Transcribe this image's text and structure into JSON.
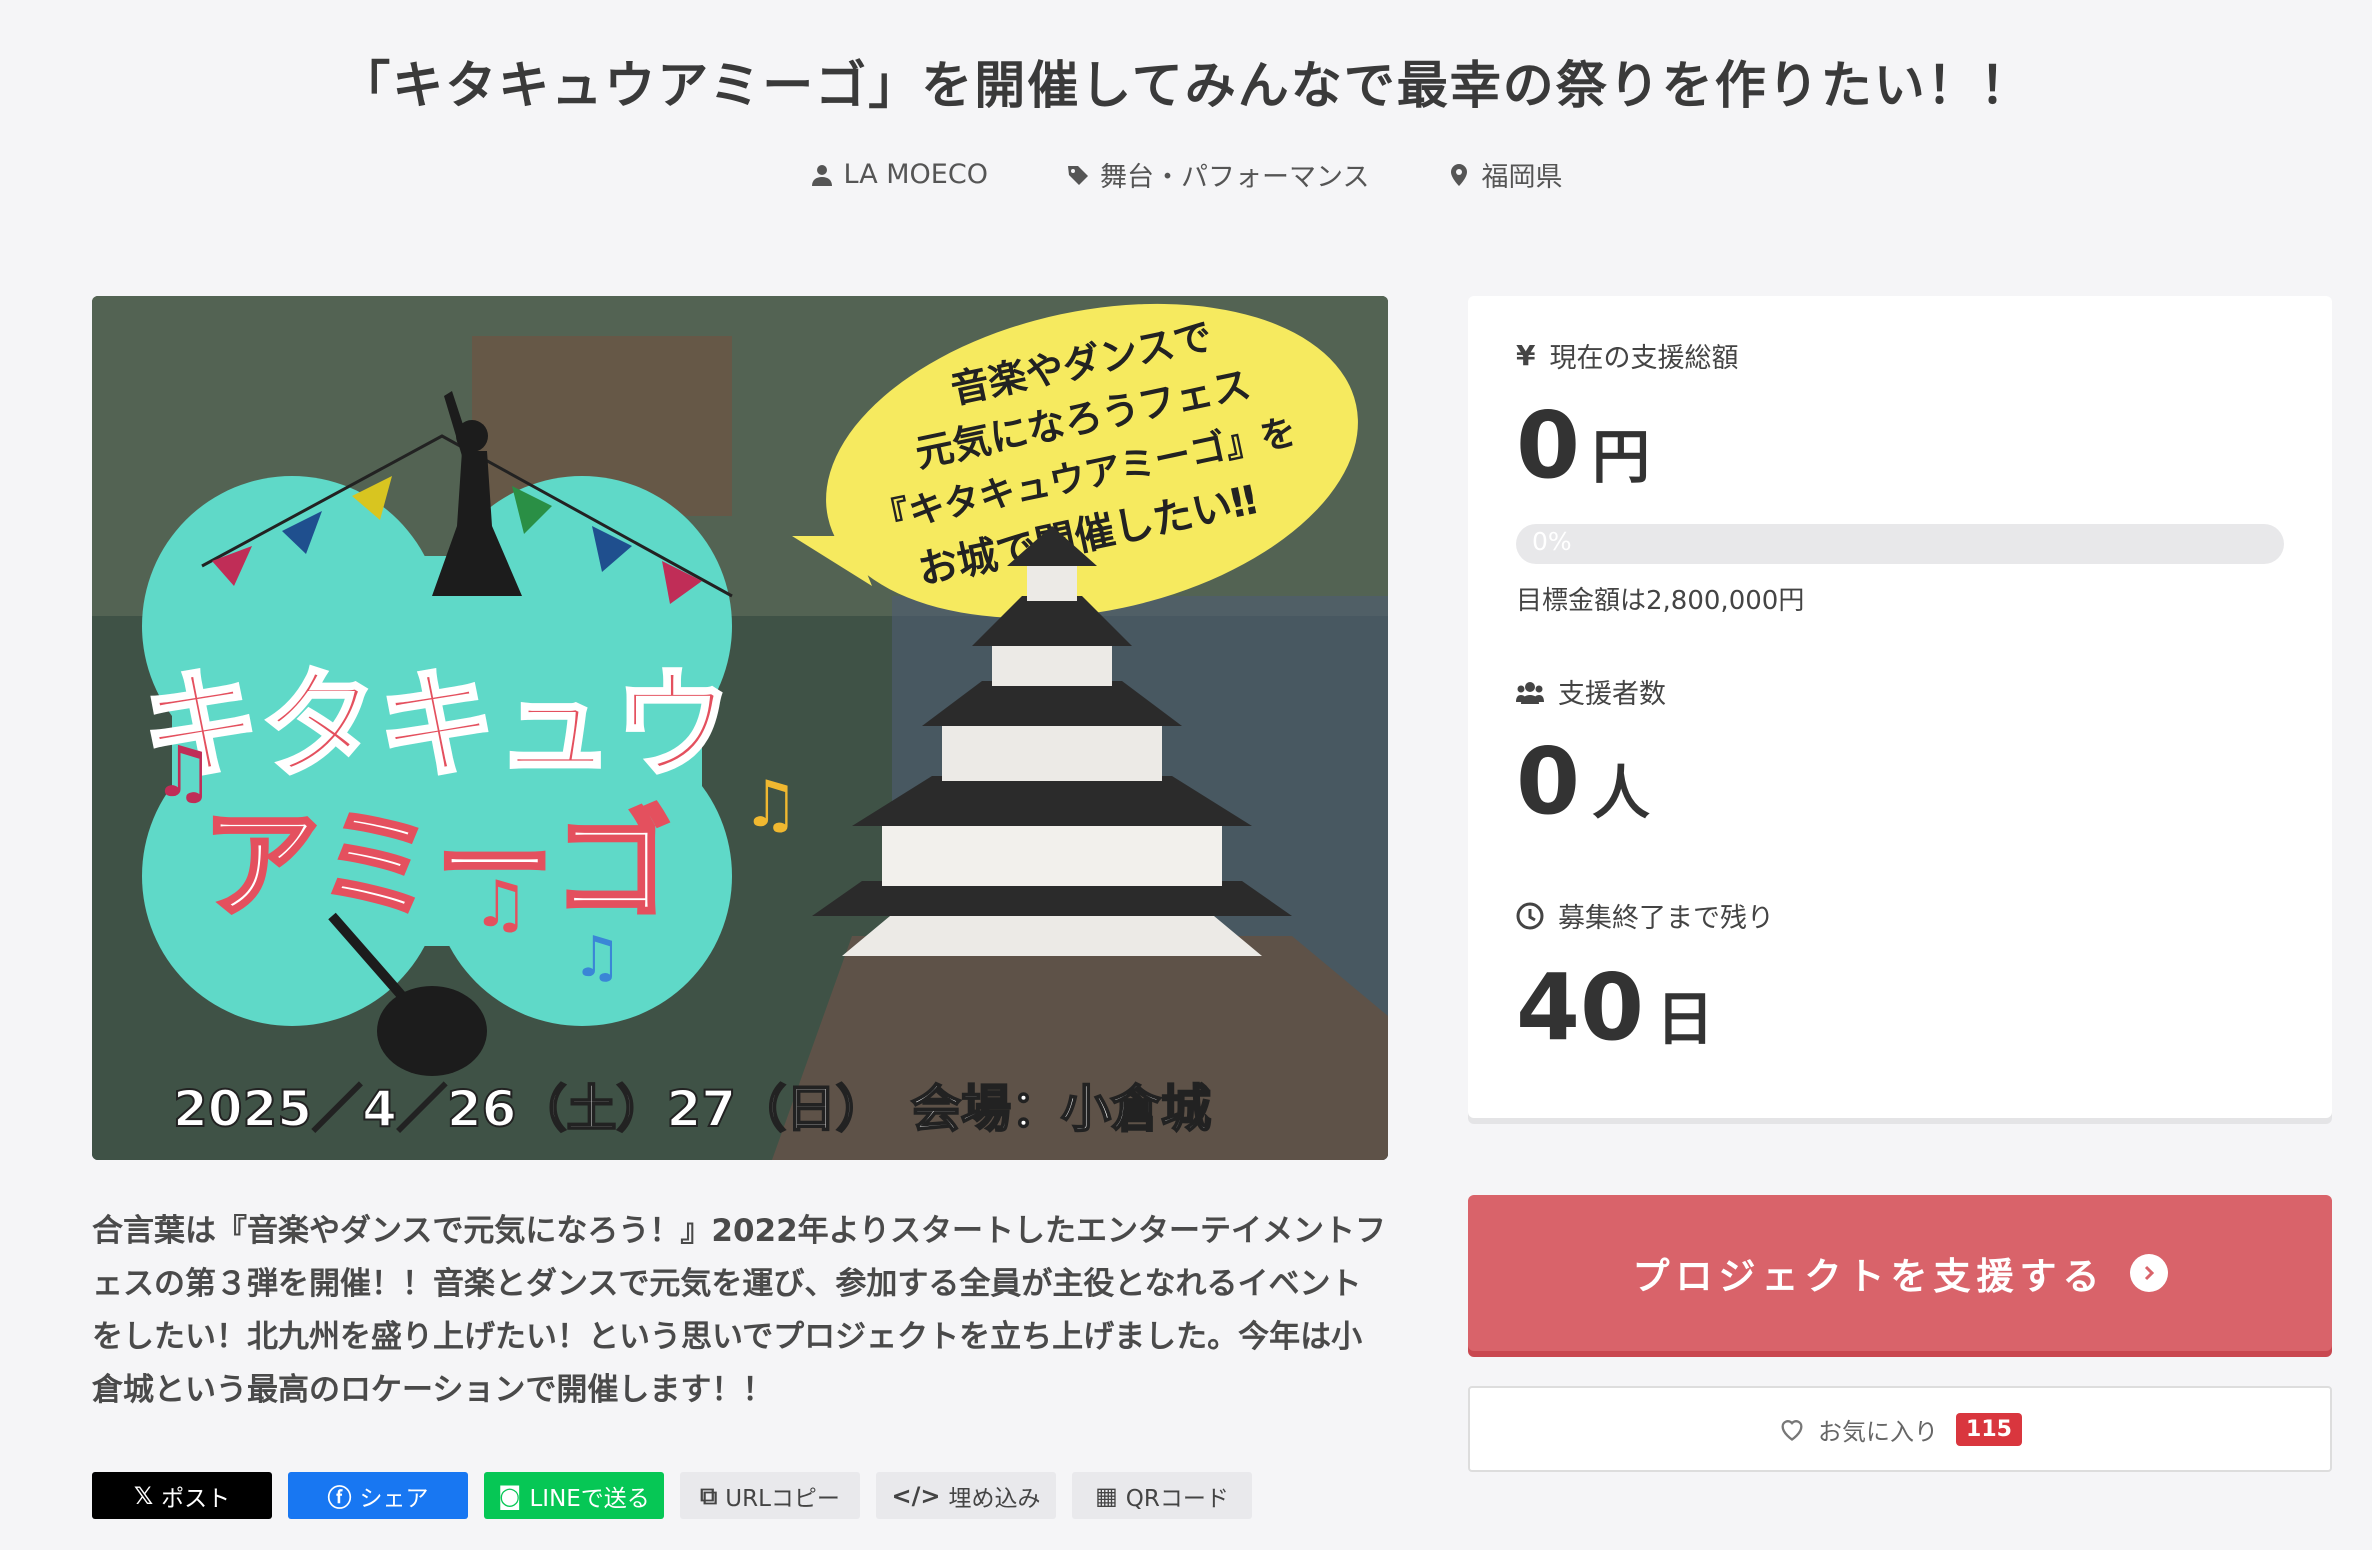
{
  "project": {
    "title": "「キタキュウアミーゴ」を開催してみんなで最幸の祭りを作りたい！！",
    "author": "LA MOECO",
    "category": "舞台・パフォーマンス",
    "location": "福岡県"
  },
  "hero": {
    "bubble_lines": [
      "音楽やダンスで",
      "元気になろうフェス",
      "『キタキュウアミーゴ』を",
      "お城で開催したい‼"
    ],
    "logo_line1": "キタキュウ",
    "logo_line2": "アミーゴ",
    "date_venue": "2025／4／26（土）27（日）　会場：小倉城"
  },
  "description": "合言葉は『音楽やダンスで元気になろう！』2022年よりスタートしたエンターテイメントフェスの第３弾を開催！！音楽とダンスで元気を運び、参加する全員が主役となれるイベントをしたい！北九州を盛り上げたい！という思いでプロジェクトを立ち上げました。今年は小倉城という最高のロケーションで開催します！！",
  "share": {
    "x_label": "ポスト",
    "facebook_label": "シェア",
    "line_label": "LINEで送る",
    "url_label": "URLコピー",
    "embed_label": "埋め込み",
    "qr_label": "QRコード"
  },
  "stats": {
    "amount_label": "現在の支援総額",
    "amount_value": "0",
    "amount_unit": "円",
    "progress_text": "0%",
    "progress_fraction": 0,
    "goal_text": "目標金額は2,800,000円",
    "supporters_label": "支援者数",
    "supporters_value": "0",
    "supporters_unit": "人",
    "remaining_label": "募集終了まで残り",
    "remaining_value": "40",
    "remaining_unit": "日"
  },
  "actions": {
    "support_label": "プロジェクトを支援する",
    "favorite_label": "お気に入り",
    "favorite_count": "115"
  },
  "colors": {
    "accent": "#d9636a",
    "badge": "#d9363e",
    "x": "#000000",
    "facebook": "#1877f2",
    "line": "#06c755"
  }
}
